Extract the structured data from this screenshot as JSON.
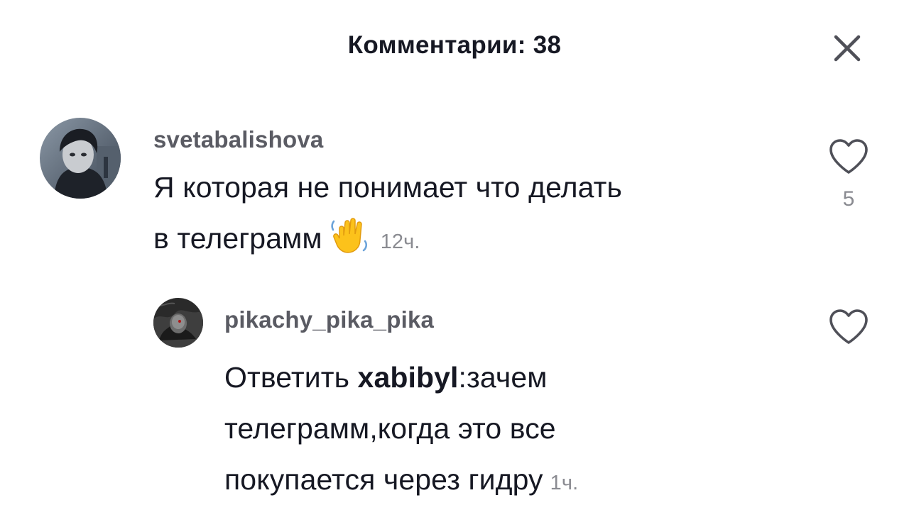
{
  "header": {
    "title": "Комментарии: 38"
  },
  "icons": {
    "close": "close-icon",
    "like": "heart-outline-icon",
    "emoji": "waving-hand-emoji"
  },
  "colors": {
    "text": "#161823",
    "username": "#5a5b63",
    "secondary": "#8a8b91",
    "icon": "#4f5058"
  },
  "comments": [
    {
      "username": "svetabalishova",
      "text_line1": "Я которая не понимает что делать",
      "text_line2": "в телеграмм",
      "emoji": "👋",
      "timestamp": "12ч.",
      "likes": "5"
    }
  ],
  "replies": [
    {
      "username": "pikachy_pika_pika",
      "reply_prefix": "Ответить ",
      "mention": "xabibyl",
      "text_line1_rest": ":зачем",
      "text_line2": "телеграмм,когда это все",
      "text_line3": "покупается через гидру",
      "timestamp": "1ч."
    }
  ]
}
